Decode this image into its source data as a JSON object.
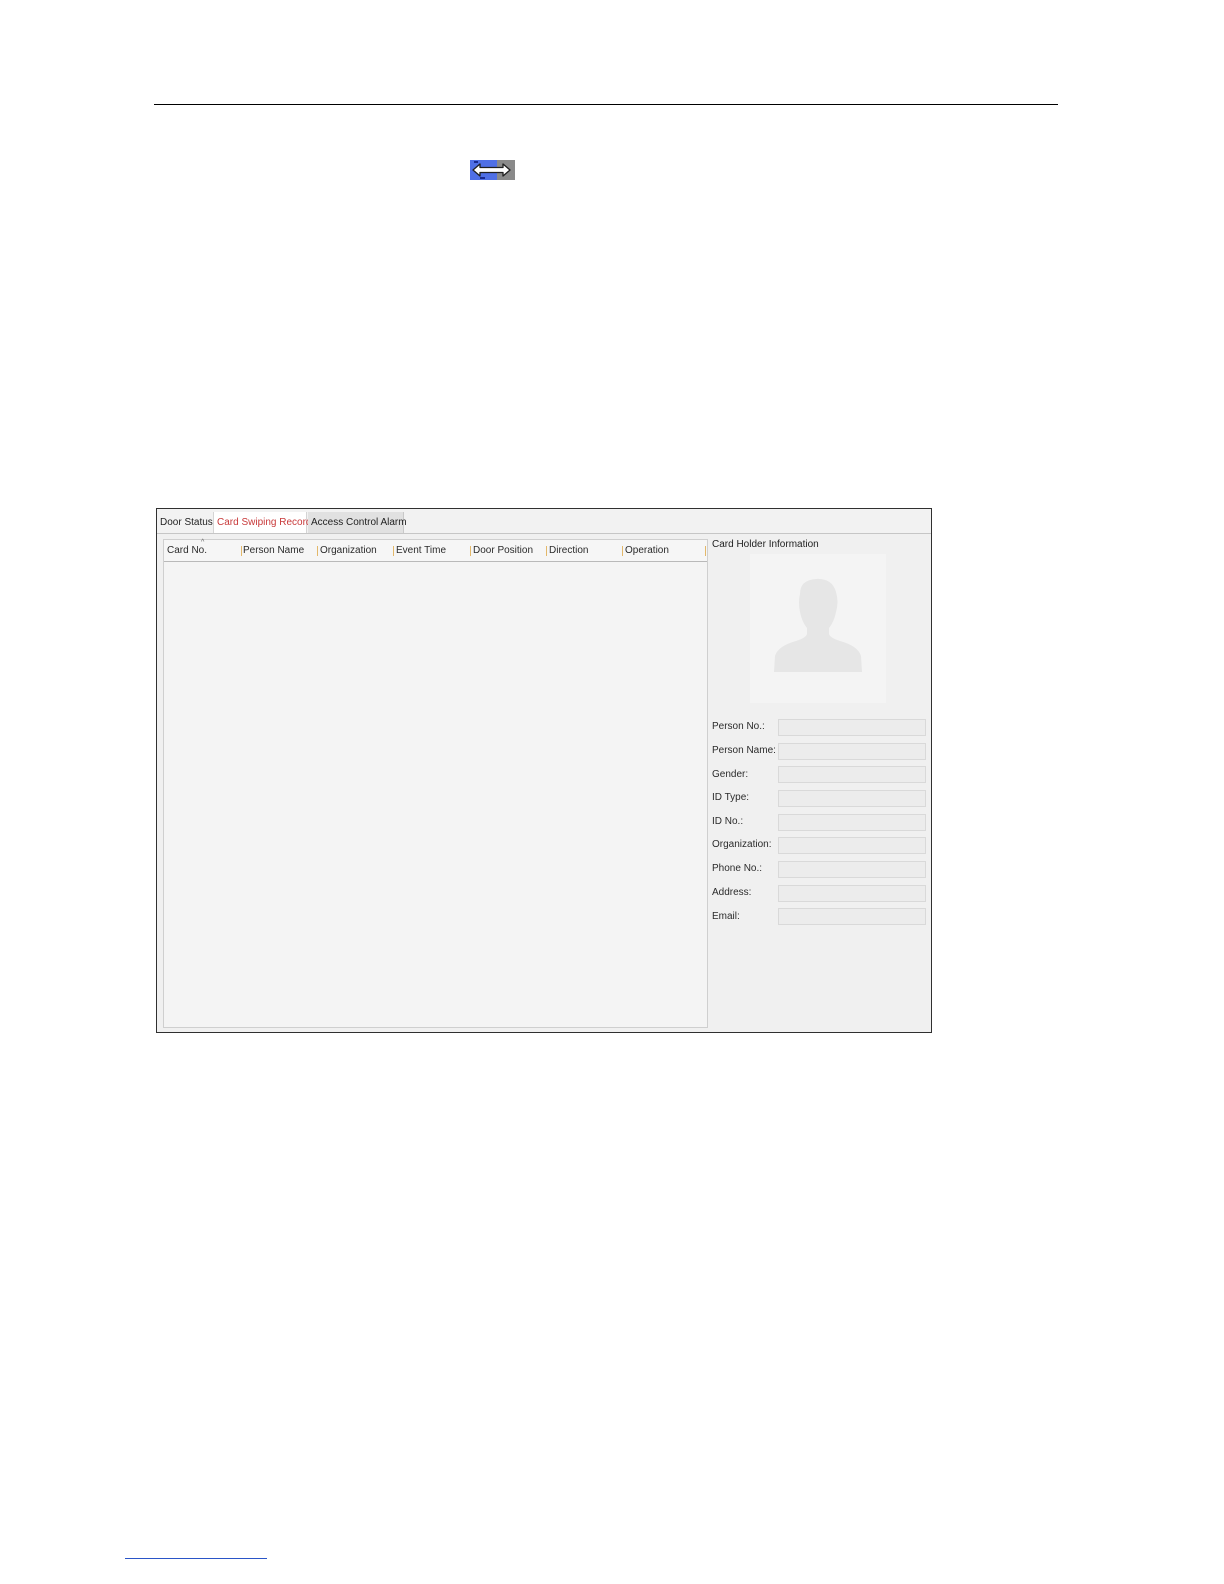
{
  "tabs": [
    {
      "label": "Door Status",
      "active": false
    },
    {
      "label": "Card Swiping Record",
      "active": true
    },
    {
      "label": "Access Control Alarm",
      "active": false
    }
  ],
  "table": {
    "columns": [
      "Card No.",
      "Person Name",
      "Organization",
      "Event Time",
      "Door Position",
      "Direction",
      "Operation"
    ],
    "sort_indicator": "^",
    "rows": []
  },
  "card_holder": {
    "title": "Card Holder Information",
    "photo_icon": "person-silhouette-icon",
    "fields": [
      {
        "label": "Person No.:",
        "value": ""
      },
      {
        "label": "Person Name:",
        "value": ""
      },
      {
        "label": "Gender:",
        "value": ""
      },
      {
        "label": "ID Type:",
        "value": ""
      },
      {
        "label": "ID No.:",
        "value": ""
      },
      {
        "label": "Organization:",
        "value": ""
      },
      {
        "label": "Phone No.:",
        "value": ""
      },
      {
        "label": "Address:",
        "value": ""
      },
      {
        "label": "Email:",
        "value": ""
      }
    ]
  },
  "colors": {
    "active_tab_text": "#c8393a",
    "icon_blue": "#4f6fe6",
    "icon_gray": "#8a8a8a"
  },
  "icons": {
    "toolbar_icon": "bidirectional-arrow-icon"
  }
}
